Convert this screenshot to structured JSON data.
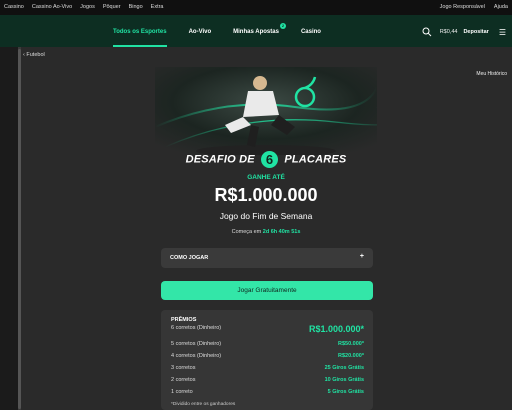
{
  "topbar": {
    "left": [
      "Cassino",
      "Cassino Ao-Vivo",
      "Jogos",
      "Pôquer",
      "Bingo",
      "Extra"
    ],
    "right": [
      "Jogo Responsável",
      "Ajuda"
    ]
  },
  "nav": {
    "tabs": [
      {
        "label": "Todos os Esportes",
        "active": true
      },
      {
        "label": "Ao-Vivo",
        "active": false
      },
      {
        "label": "Minhas Apostas",
        "active": false,
        "badge": "2"
      },
      {
        "label": "Casino",
        "active": false
      }
    ],
    "balance": "R$0,44",
    "deposit_label": "Depositar",
    "accent": "#20e3a3"
  },
  "breadcrumb": "Futebol",
  "history_link": "Meu Histórico",
  "challenge": {
    "title_left": "DESAFIO DE",
    "title_number": "6",
    "title_right": "PLACARES",
    "subtitle": "GANHE ATÉ",
    "amount": "R$1.000.000",
    "name": "Jogo do Fim de Semana",
    "starts_label": "Começa em",
    "countdown": "2d 6h 40m 51s"
  },
  "how_to_play": {
    "label": "COMO JOGAR",
    "icon": "plus-icon"
  },
  "play_button": "Jogar Gratuitamente",
  "prizes": {
    "header": "PRÊMIOS",
    "rows": [
      {
        "label": "6 corretos (Dinheiro)",
        "value": "R$1.000.000*"
      },
      {
        "label": "5 corretos (Dinheiro)",
        "value": "R$50.000*"
      },
      {
        "label": "4 corretos (Dinheiro)",
        "value": "R$20.000*"
      },
      {
        "label": "3 corretos",
        "value": "25 Giros Grátis"
      },
      {
        "label": "2 corretos",
        "value": "10 Giros Grátis"
      },
      {
        "label": "1 correto",
        "value": "5 Giros Grátis"
      }
    ],
    "note": "*Dividido entre os ganhadores"
  }
}
